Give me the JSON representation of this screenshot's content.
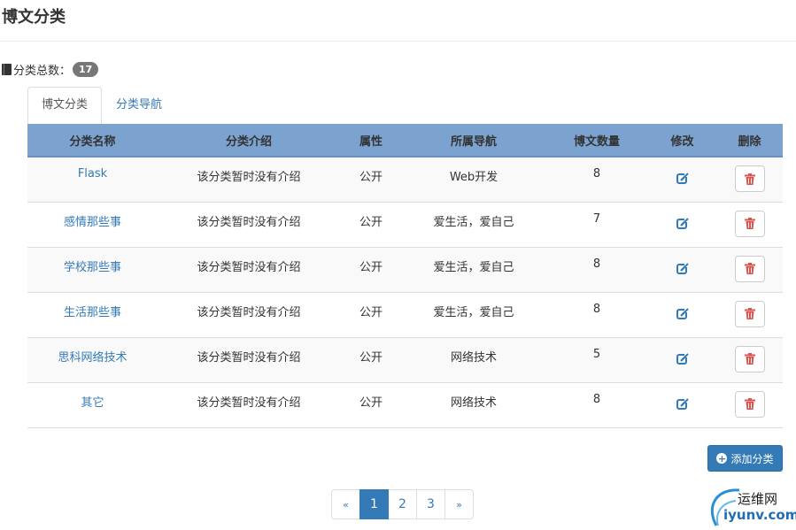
{
  "page": {
    "title": "博文分类"
  },
  "summary": {
    "label": "分类总数：",
    "count": "17"
  },
  "tabs": [
    {
      "label": "博文分类",
      "active": true
    },
    {
      "label": "分类导航",
      "active": false
    }
  ],
  "table": {
    "headers": [
      "分类名称",
      "分类介绍",
      "属性",
      "所属导航",
      "博文数量",
      "修改",
      "删除"
    ],
    "rows": [
      {
        "name": "Flask",
        "desc": "该分类暂时没有介绍",
        "attr": "公开",
        "nav": "Web开发",
        "count": "8"
      },
      {
        "name": "感情那些事",
        "desc": "该分类暂时没有介绍",
        "attr": "公开",
        "nav": "爱生活，爱自己",
        "count": "7"
      },
      {
        "name": "学校那些事",
        "desc": "该分类暂时没有介绍",
        "attr": "公开",
        "nav": "爱生活，爱自己",
        "count": "8"
      },
      {
        "name": "生活那些事",
        "desc": "该分类暂时没有介绍",
        "attr": "公开",
        "nav": "爱生活，爱自己",
        "count": "8"
      },
      {
        "name": "思科网络技术",
        "desc": "该分类暂时没有介绍",
        "attr": "公开",
        "nav": "网络技术",
        "count": "5"
      },
      {
        "name": "其它",
        "desc": "该分类暂时没有介绍",
        "attr": "公开",
        "nav": "网络技术",
        "count": "8"
      }
    ]
  },
  "actions": {
    "edit_icon": "edit-icon",
    "delete_icon": "trash-icon",
    "add_label": "添加分类"
  },
  "pagination": {
    "prev": "«",
    "pages": [
      "1",
      "2",
      "3"
    ],
    "current": "1",
    "next": "»"
  },
  "watermark": {
    "line1": "运维网",
    "line2": "iyunv.com"
  },
  "colors": {
    "header_bg": "#7ca2cf",
    "link": "#337ab7",
    "danger": "#d9534f",
    "primary": "#337ab7"
  }
}
